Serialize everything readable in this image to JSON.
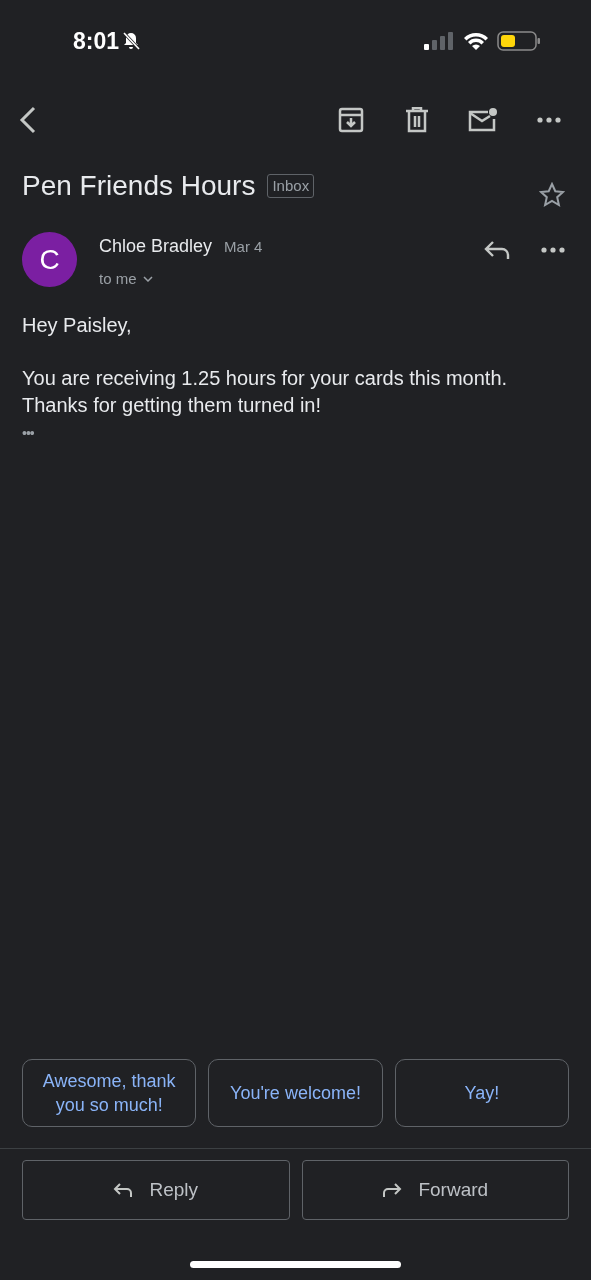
{
  "status_bar": {
    "time": "8:01"
  },
  "subject": {
    "title": "Pen Friends Hours",
    "label": "Inbox",
    "starred": false
  },
  "message": {
    "avatar_letter": "C",
    "sender": "Chloe Bradley",
    "date": "Mar 4",
    "recipient": "to me",
    "body": [
      "Hey Paisley,",
      "You are receiving 1.25 hours for your cards this month. Thanks for getting them turned in!"
    ],
    "trimmed_content": "•••"
  },
  "smart_replies": [
    "Awesome, thank you so much!",
    "You're welcome!",
    "Yay!"
  ],
  "actions": [
    {
      "kind": "reply",
      "label": "Reply"
    },
    {
      "kind": "forward",
      "label": "Forward"
    }
  ]
}
